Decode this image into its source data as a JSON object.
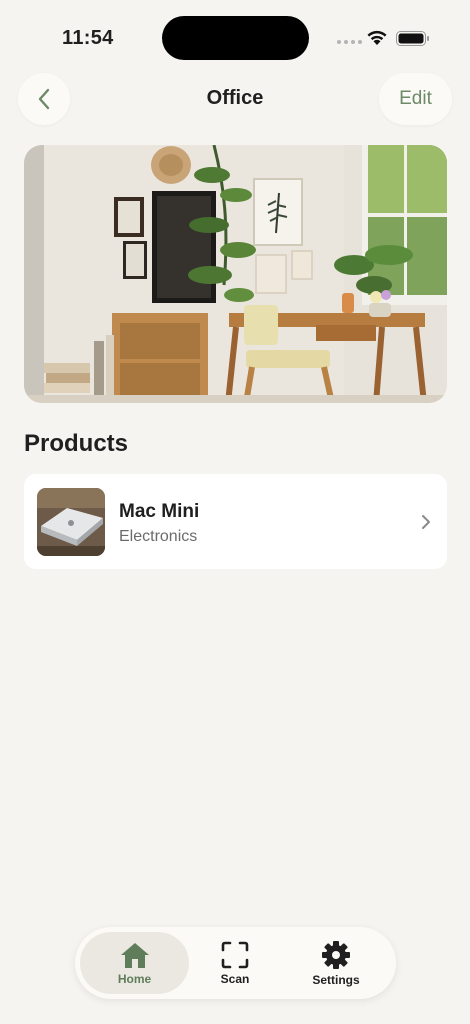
{
  "status_bar": {
    "time": "11:54"
  },
  "nav": {
    "title": "Office",
    "edit_label": "Edit"
  },
  "products_section": {
    "title": "Products",
    "items": [
      {
        "name": "Mac Mini",
        "category": "Electronics"
      }
    ]
  },
  "tab_bar": {
    "tabs": [
      {
        "label": "Home",
        "icon": "home-icon",
        "active": true
      },
      {
        "label": "Scan",
        "icon": "scan-icon",
        "active": false
      },
      {
        "label": "Settings",
        "icon": "gear-icon",
        "active": false
      }
    ]
  },
  "colors": {
    "accent": "#6c8a67",
    "background": "#f6f4f0",
    "card": "#ffffff"
  }
}
